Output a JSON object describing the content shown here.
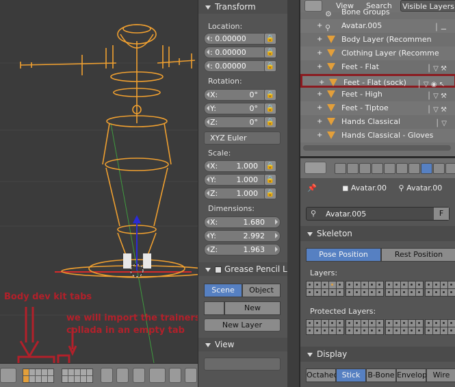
{
  "viewport": {
    "annotations": {
      "body_dev_kit": "Body dev kit tabs",
      "import_note_line1": "we will import the trainers",
      "import_note_line2": "collada in an empty tab"
    },
    "colors": {
      "armature": "#f0a030",
      "annotation": "#b2202a",
      "y_axis": "#2b2bd6",
      "x_axis": "#d62b2b"
    }
  },
  "npanel": {
    "transform": {
      "title": "Transform",
      "location_label": "Location:",
      "location": [
        ": 0.00000",
        ": 0.00000",
        ": 0.00000"
      ],
      "rotation_label": "Rotation:",
      "rotation": [
        {
          "axis": "X:",
          "value": "0°"
        },
        {
          "axis": "Y:",
          "value": "0°"
        },
        {
          "axis": "Z:",
          "value": "0°"
        }
      ],
      "rotation_mode": "XYZ Euler",
      "scale_label": "Scale:",
      "scale": [
        {
          "axis": "X:",
          "value": "1.000"
        },
        {
          "axis": "Y:",
          "value": "1.000"
        },
        {
          "axis": "Z:",
          "value": "1.000"
        }
      ],
      "dimensions_label": "Dimensions:",
      "dimensions": [
        {
          "axis": "X:",
          "value": "1.680"
        },
        {
          "axis": "Y:",
          "value": "2.992"
        },
        {
          "axis": "Z:",
          "value": "1.963"
        }
      ]
    },
    "grease_pencil": {
      "title": "Grease Pencil L",
      "scene_label": "Scene",
      "object_label": "Object",
      "new_label": "New",
      "new_layer_label": "New Layer"
    },
    "view": {
      "title": "View"
    }
  },
  "outliner": {
    "tabs": [
      "View",
      "Search",
      "Visible Layers"
    ],
    "rows": [
      {
        "name": "Bone Groups",
        "kind": "group"
      },
      {
        "name": "Avatar.005",
        "kind": "armature"
      },
      {
        "name": "Body Layer (Recommen",
        "kind": "object"
      },
      {
        "name": "Clothing Layer (Recomme",
        "kind": "object"
      },
      {
        "name": "Feet - Flat",
        "kind": "object"
      },
      {
        "name": "Feet - Flat (sock)",
        "kind": "object",
        "highlighted": true
      },
      {
        "name": "Feet - High",
        "kind": "object"
      },
      {
        "name": "Feet - Tiptoe",
        "kind": "object"
      },
      {
        "name": "Hands Classical",
        "kind": "object"
      },
      {
        "name": "Hands Classical - Gloves",
        "kind": "object"
      }
    ]
  },
  "properties": {
    "breadcrumb_mesh": "Avatar.00",
    "breadcrumb_arm": "Avatar.00",
    "datablock_name": "Avatar.005",
    "datablock_f": "F",
    "skeleton": {
      "title": "Skeleton",
      "pose_position": "Pose Position",
      "rest_position": "Rest Position",
      "layers_label": "Layers:",
      "protected_label": "Protected Layers:"
    },
    "display": {
      "title": "Display",
      "options": [
        "Octahed",
        "Stick",
        "B-Bone",
        "Envelop",
        "Wire"
      ],
      "selected": "Stick"
    }
  }
}
